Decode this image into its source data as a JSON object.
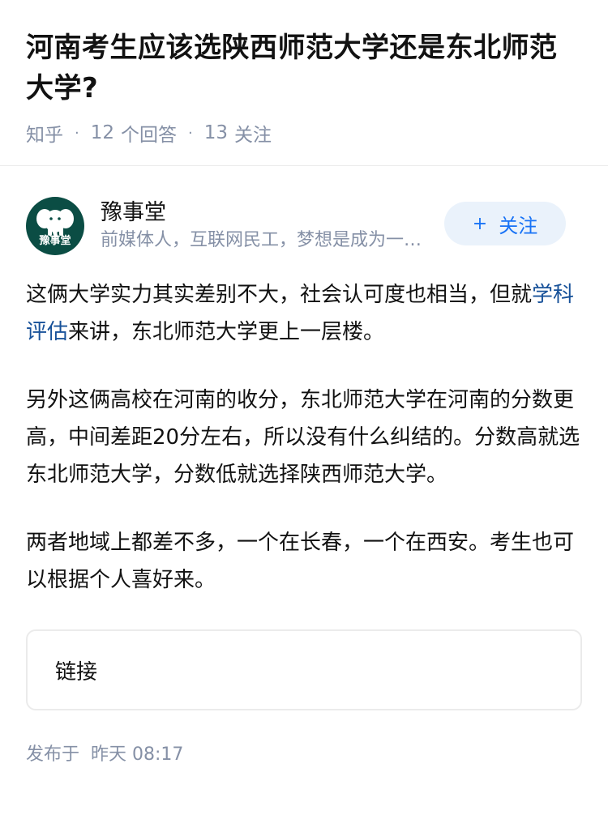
{
  "question": {
    "title": "河南考生应该选陕西师范大学还是东北师范大学?",
    "source": "知乎",
    "answer_count": "12",
    "answer_label": "个回答",
    "follow_count": "13",
    "follow_label": "关注"
  },
  "author": {
    "avatar_text": "豫事堂",
    "name": "豫事堂",
    "bio": "前媒体人，互联网民工，梦想是成为一名作家",
    "follow_button": "关注",
    "follow_plus": "+"
  },
  "answer": {
    "p1_a": "这俩大学实力其实差别不大，社会认可度也相当，但就",
    "p1_link": "学科评估",
    "p1_b": "来讲，东北师范大学更上一层楼。",
    "p2": "另外这俩高校在河南的收分，东北师范大学在河南的分数更高，中间差距20分左右，所以没有什么纠结的。分数高就选东北师范大学，分数低就选择陕西师范大学。",
    "p3": "两者地域上都差不多，一个在长春，一个在西安。考生也可以根据个人喜好来。"
  },
  "link_card": {
    "label": "链接"
  },
  "publish": {
    "label": "发布于",
    "time": "昨天 08:17"
  },
  "colors": {
    "accent": "#1772f6",
    "link": "#175199",
    "meta": "#8590a6",
    "avatar_bg": "#0b4d44",
    "follow_bg": "#eaf2fb"
  }
}
